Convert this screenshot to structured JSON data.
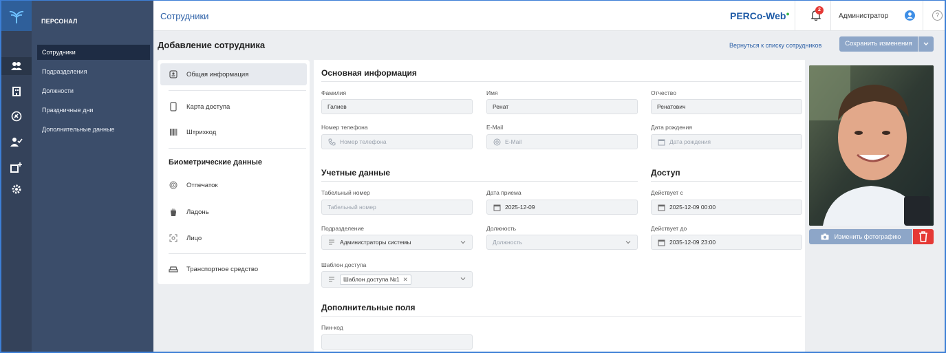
{
  "sidebar": {
    "section_title": "ПЕРСОНАЛ",
    "items": [
      {
        "label": "Сотрудники"
      },
      {
        "label": "Подразделения"
      },
      {
        "label": "Должности"
      },
      {
        "label": "Праздничные дни"
      },
      {
        "label": "Дополнительные данные"
      }
    ]
  },
  "rail": {
    "icons": [
      "personnel-icon",
      "building-icon",
      "vehicle-icon",
      "user-check-icon",
      "building-add-icon",
      "settings-icon"
    ]
  },
  "header": {
    "breadcrumb": "Сотрудники",
    "brand": "PERCo-Web",
    "brand_dot": "●",
    "notifications_count": "2",
    "user_name": "Администратор",
    "help": "?"
  },
  "page": {
    "title": "Добавление сотрудника",
    "back_link": "Вернуться к списку сотрудников",
    "save_label": "Сохранить изменения"
  },
  "tabs": {
    "general": "Общая информация",
    "card": "Карта доступа",
    "barcode": "Штрихкод",
    "biometrics_title": "Биометрические данные",
    "fingerprint": "Отпечаток",
    "palm": "Ладонь",
    "face": "Лицо",
    "vehicle": "Транспортное средство"
  },
  "basic": {
    "title": "Основная информация",
    "last_name_label": "Фамилия",
    "last_name": "Галиев",
    "first_name_label": "Имя",
    "first_name": "Ренат",
    "middle_name_label": "Отчество",
    "middle_name": "Ренатович",
    "phone_label": "Номер телефона",
    "phone_placeholder": "Номер телефона",
    "email_label": "E-Mail",
    "email_placeholder": "E-Mail",
    "birth_label": "Дата рождения",
    "birth_placeholder": "Дата рождения"
  },
  "account": {
    "title": "Учетные данные",
    "tab_number_label": "Табельный номер",
    "tab_number_placeholder": "Табельный номер",
    "hire_date_label": "Дата приема",
    "hire_date": "2025-12-09",
    "department_label": "Подразделение",
    "department": "Администраторы системы",
    "position_label": "Должность",
    "position_placeholder": "Должность",
    "template_label": "Шаблон доступа",
    "template_chip": "Шаблон доступа №1"
  },
  "access": {
    "title": "Доступ",
    "from_label": "Действует с",
    "from": "2025-12-09 00:00",
    "to_label": "Действует до",
    "to": "2035-12-09 23:00"
  },
  "extra": {
    "title": "Дополнительные поля",
    "pin_label": "Пин-код",
    "pin": ""
  },
  "photo": {
    "change_label": "Изменить фотографию"
  },
  "colors": {
    "accent": "#2f62a8",
    "sidebar": "#3b4d6a",
    "rail": "#34425a",
    "button": "#8da6c8",
    "danger": "#e53935"
  }
}
